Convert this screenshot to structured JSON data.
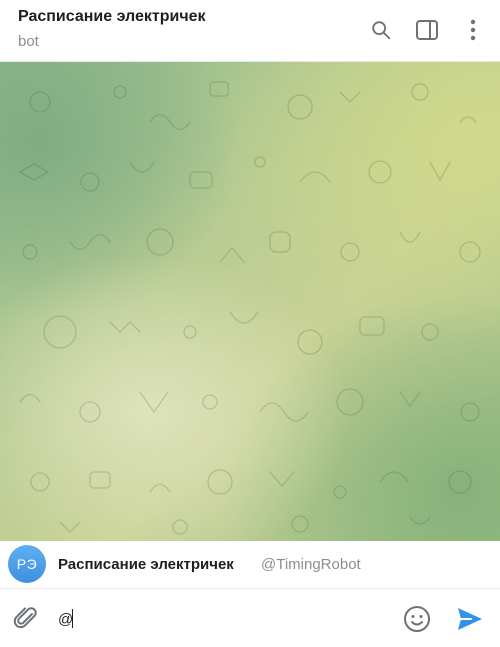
{
  "header": {
    "title": "Расписание электричек",
    "subtitle": "bot",
    "icons": [
      "search-icon",
      "sidebar-toggle-icon",
      "more-vertical-icon"
    ]
  },
  "inline_bot": {
    "avatar_initials": "РЭ",
    "name": "Расписание электричек",
    "username": "@TimingRobot",
    "avatar_color": "#4a9fe8"
  },
  "composer": {
    "input_value": "@",
    "icons": [
      "attach-icon",
      "emoji-icon",
      "send-icon"
    ],
    "accent_color": "#3390ec"
  }
}
